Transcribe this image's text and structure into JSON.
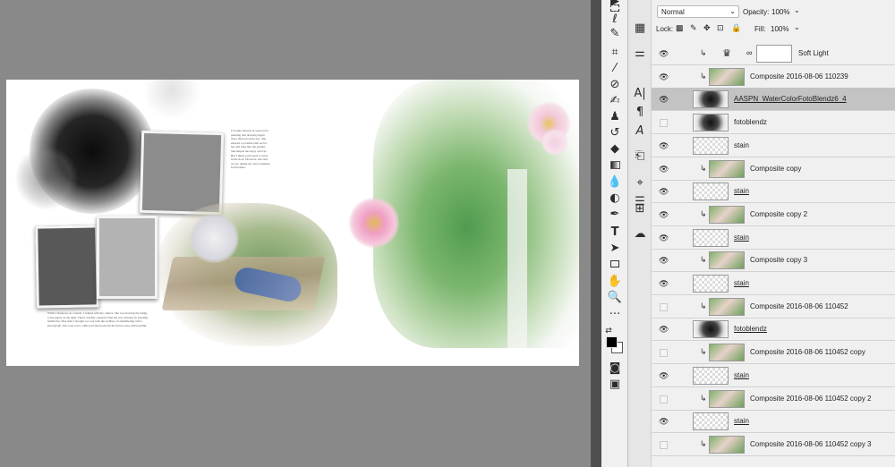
{
  "options_bar": {
    "blend_mode": "Normal",
    "opacity_label": "Opacity:",
    "opacity_value": "100%",
    "lock_label": "Lock:",
    "fill_label": "Fill:",
    "fill_value": "100%"
  },
  "layers": [
    {
      "name": "Soft Light",
      "visible": true,
      "clipped": true,
      "thumb": "adjustment",
      "selected": false,
      "underline": false
    },
    {
      "name": "Composite 2016-08-06 110239",
      "visible": true,
      "clipped": true,
      "thumb": "photo",
      "selected": false,
      "underline": false
    },
    {
      "name": "AASPN_WaterColorFotoBlendz6_4",
      "visible": true,
      "clipped": false,
      "thumb": "blend",
      "selected": true,
      "underline": true
    },
    {
      "name": "fotoblendz",
      "visible": false,
      "clipped": false,
      "thumb": "blend",
      "selected": false,
      "underline": false
    },
    {
      "name": "stain",
      "visible": true,
      "clipped": false,
      "thumb": "checker",
      "selected": false,
      "underline": false
    },
    {
      "name": "Composite copy",
      "visible": true,
      "clipped": true,
      "thumb": "photo",
      "selected": false,
      "underline": false
    },
    {
      "name": "stain",
      "visible": true,
      "clipped": false,
      "thumb": "checker",
      "selected": false,
      "underline": true
    },
    {
      "name": "Composite copy 2",
      "visible": true,
      "clipped": true,
      "thumb": "photo",
      "selected": false,
      "underline": false
    },
    {
      "name": "stain",
      "visible": true,
      "clipped": false,
      "thumb": "checker",
      "selected": false,
      "underline": true
    },
    {
      "name": "Composite copy 3",
      "visible": true,
      "clipped": true,
      "thumb": "photo",
      "selected": false,
      "underline": false
    },
    {
      "name": "stain",
      "visible": true,
      "clipped": false,
      "thumb": "checker",
      "selected": false,
      "underline": true
    },
    {
      "name": "Composite 2016-08-06 110452",
      "visible": false,
      "clipped": true,
      "thumb": "photo",
      "selected": false,
      "underline": false
    },
    {
      "name": "fotoblendz",
      "visible": true,
      "clipped": false,
      "thumb": "blend",
      "selected": false,
      "underline": true
    },
    {
      "name": "Composite 2016-08-06 110452 copy",
      "visible": false,
      "clipped": true,
      "thumb": "photo",
      "selected": false,
      "underline": false
    },
    {
      "name": "stain",
      "visible": true,
      "clipped": false,
      "thumb": "checker",
      "selected": false,
      "underline": true
    },
    {
      "name": "Composite 2016-08-06 110452 copy 2",
      "visible": false,
      "clipped": true,
      "thumb": "photo",
      "selected": false,
      "underline": false
    },
    {
      "name": "stain",
      "visible": true,
      "clipped": false,
      "thumb": "checker",
      "selected": false,
      "underline": true
    },
    {
      "name": "Composite 2016-08-06 110452 copy 3",
      "visible": false,
      "clipped": true,
      "thumb": "photo",
      "selected": false,
      "underline": false
    }
  ],
  "tools": [
    "move-tool",
    "marquee-tool",
    "lasso-tool",
    "quick-select-tool",
    "crop-tool",
    "eyedropper-tool",
    "healing-brush-tool",
    "brush-tool",
    "clone-stamp-tool",
    "history-brush-tool",
    "eraser-tool",
    "gradient-tool",
    "blur-tool",
    "dodge-tool",
    "pen-tool",
    "type-tool",
    "path-select-tool",
    "rectangle-tool",
    "hand-tool",
    "zoom-tool"
  ],
  "document": {
    "caption_text": "While I drank tea on a bench, I walked with my camera. She was drawing the bridge to the plants on the right. Then I actually captured what she was drawing by standing behind her. That time I thought we took both the realities of remembering with a photograph. The roses were a little past their peak but the leaves were still beautiful.",
    "side_text": "I'd rather interest in watercolor painting and drawing began more than ten years ago. She entered a portable bath set for her and trips into the garden. She helped me enjoy our trip. But I think you'd need to relax in the door. However, she said we are taking up colors painting from nature."
  }
}
